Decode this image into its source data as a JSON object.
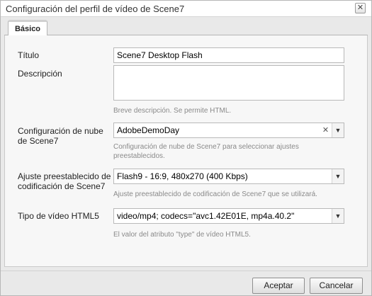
{
  "dialog": {
    "title": "Configuración del perfil de vídeo de Scene7",
    "close_symbol": "✕"
  },
  "tabs": [
    {
      "label": "Básico"
    }
  ],
  "form": {
    "title": {
      "label": "Título",
      "value": "Scene7 Desktop Flash"
    },
    "description": {
      "label": "Descripción",
      "value": "",
      "hint": "Breve descripción. Se permite HTML."
    },
    "cloud_config": {
      "label_line1": "Configuración de nube",
      "label_line2": "de Scene7",
      "value": "AdobeDemoDay",
      "hint_line1": "Configuración de nube de Scene7 para seleccionar ajustes",
      "hint_line2": "preestablecidos.",
      "clear_symbol": "✕",
      "dropdown_symbol": "▼"
    },
    "encoding_preset": {
      "label_line1": "Ajuste preestablecido de",
      "label_line2": "codificación de Scene7",
      "value": "Flash9 - 16:9, 480x270 (400 Kbps)",
      "hint": "Ajuste preestablecido de codificación de Scene7 que se utilizará.",
      "dropdown_symbol": "▼"
    },
    "html5_type": {
      "label": "Tipo de vídeo HTML5",
      "value": "video/mp4; codecs=\"avc1.42E01E, mp4a.40.2\"",
      "hint": "El valor del atributo \"type\" de vídeo HTML5.",
      "dropdown_symbol": "▼"
    }
  },
  "footer": {
    "accept_label": "Aceptar",
    "cancel_label": "Cancelar"
  }
}
